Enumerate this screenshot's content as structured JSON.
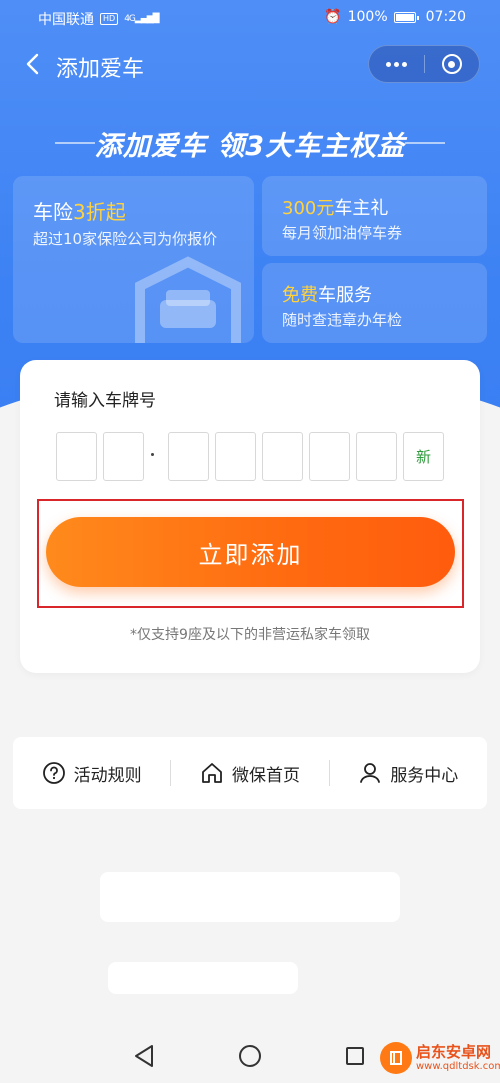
{
  "status_bar": {
    "carrier": "中国联通",
    "hd": "HD",
    "network": "4G",
    "battery": "100%",
    "time": "07:20"
  },
  "nav": {
    "title": "添加爱车",
    "back_icon": "chevron-left-icon",
    "more_icon": "more-dots-icon",
    "close_icon": "target-circle-icon"
  },
  "banner": {
    "title": "添加爱车 领3大车主权益"
  },
  "benefits": {
    "insurance": {
      "title_prefix": "车险",
      "title_highlight": "3折起",
      "subtitle": "超过10家保险公司为你报价"
    },
    "gift": {
      "title_highlight": "300元",
      "title_suffix": "车主礼",
      "subtitle": "每月领加油停车券"
    },
    "service": {
      "title_highlight": "免费",
      "title_suffix": "车服务",
      "subtitle": "随时查违章办年检"
    }
  },
  "plate_form": {
    "label": "请输入车牌号",
    "new_energy_label": "新",
    "submit_label": "立即添加",
    "note": "*仅支持9座及以下的非营运私家车领取",
    "accent_color": "#ff6a10",
    "highlight_color": "#d9262b"
  },
  "links": [
    {
      "label": "活动规则",
      "icon": "question-circle-icon"
    },
    {
      "label": "微保首页",
      "icon": "home-icon"
    },
    {
      "label": "服务中心",
      "icon": "user-service-icon"
    }
  ],
  "watermark": {
    "name": "启东安卓网",
    "url": "www.qdltdsk.com"
  }
}
